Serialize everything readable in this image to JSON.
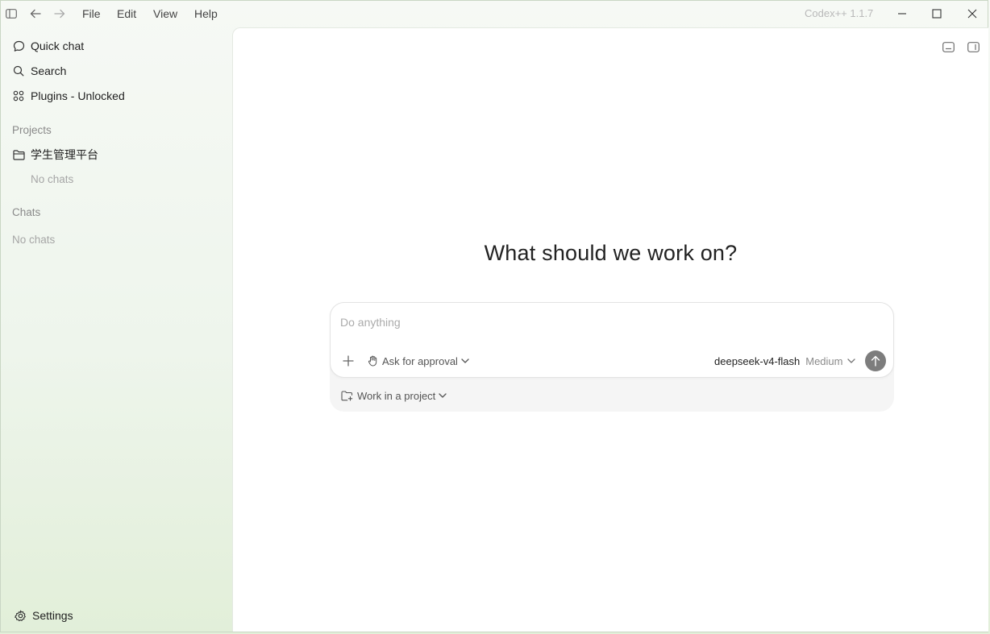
{
  "titlebar": {
    "menus": [
      "File",
      "Edit",
      "View",
      "Help"
    ],
    "app_version": "Codex++ 1.1.7"
  },
  "sidebar": {
    "nav": {
      "quick_chat": "Quick chat",
      "search": "Search",
      "plugins": "Plugins - Unlocked"
    },
    "projects_label": "Projects",
    "project": {
      "name": "学生管理平台",
      "empty": "No chats"
    },
    "chats_label": "Chats",
    "chats_empty": "No chats",
    "settings": "Settings"
  },
  "main": {
    "headline": "What should we work on?",
    "composer": {
      "placeholder": "Do anything",
      "value": "",
      "approval_label": "Ask for approval",
      "model_name": "deepseek-v4-flash",
      "effort_label": "Medium"
    },
    "project_selector": "Work in a project"
  },
  "icons": {
    "sidebar_toggle": "sidebar-toggle-icon",
    "back": "arrow-left-icon",
    "forward": "arrow-right-icon",
    "minimize": "minimize-icon",
    "maximize": "maximize-icon",
    "close": "close-icon",
    "quick_chat": "chat-bubble-icon",
    "search": "search-icon",
    "plugins": "grid-icon",
    "folder": "folder-icon",
    "settings": "gear-icon",
    "terminal_panel": "bottom-panel-icon",
    "side_panel": "side-panel-icon",
    "plus": "plus-icon",
    "hand": "hand-icon",
    "send": "arrow-up-icon",
    "project": "folder-plus-icon"
  },
  "colors": {
    "send_button": "#7d7d7d",
    "sidebar_bg": "#eef5ec",
    "main_bg": "#ffffff"
  }
}
